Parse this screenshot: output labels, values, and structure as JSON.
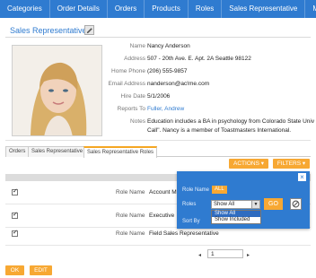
{
  "nav": {
    "items": [
      "Categories",
      "Order Details",
      "Orders",
      "Products",
      "Roles",
      "Sales Representative",
      "More"
    ]
  },
  "page": {
    "title": "Sales Representative"
  },
  "details": [
    {
      "label": "Name",
      "value": "Nancy Anderson"
    },
    {
      "label": "Address",
      "value": "507 - 20th Ave. E. Apt. 2A Seattle 98122"
    },
    {
      "label": "Home Phone",
      "value": "(206) 555-9857"
    },
    {
      "label": "Email Address",
      "value": "nanderson@ac!me.com"
    },
    {
      "label": "Hire Date",
      "value": "5/1/2006"
    },
    {
      "label": "Reports To",
      "value": "Fuller, Andrew"
    },
    {
      "label": "Notes",
      "value": "Education includes a BA in psychology from Colorado State Univ",
      "value2": "Call\". Nancy is a member of Toastmasters International."
    }
  ],
  "tabs": [
    "Orders",
    "Sales Representative",
    "Sales Representative Roles"
  ],
  "toolbar": {
    "actions_label": "ACTIONS ▾",
    "filters_label": "FILTERS ▾"
  },
  "table": {
    "rows": [
      {
        "label": "Role Name",
        "value": "Account M"
      },
      {
        "label": "Role Name",
        "value": "Executive"
      },
      {
        "label": "Role Name",
        "value": "Field Sales Representative"
      }
    ]
  },
  "pager": {
    "prev": "◂",
    "page": "1",
    "next": "▸"
  },
  "filter_popup": {
    "close": "×",
    "role_name_label": "Role Name",
    "role_name_value": "ALL",
    "roles_label": "Roles",
    "roles_selected": "Show All",
    "go_label": "GO",
    "sort_by_label": "Sort By",
    "options": [
      "Show All",
      "Show Included"
    ]
  },
  "footer": {
    "ok_label": "OK",
    "edit_label": "EDIT"
  },
  "colors": {
    "nav": "#2f7bd0",
    "accent": "#f7a833"
  },
  "icons": [
    "pencil-icon",
    "clear-filter-icon",
    "close-icon"
  ]
}
